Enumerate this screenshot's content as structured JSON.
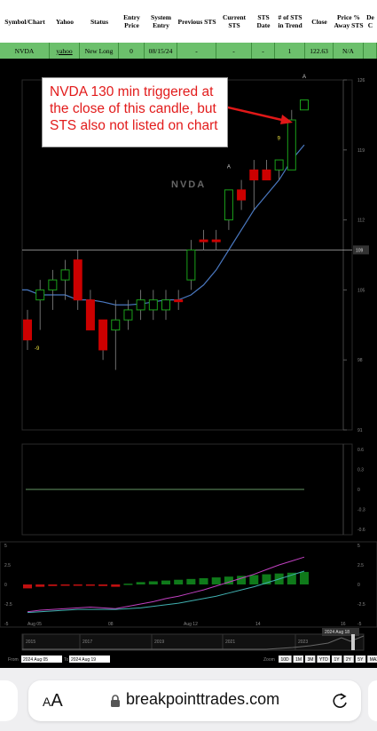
{
  "table": {
    "headers": [
      "Symbol/Chart",
      "Yahoo",
      "Status",
      "Entry Price",
      "System Entry",
      "Previous STS",
      "Current STS",
      "STS Date",
      "# of STS in Trend",
      "Close",
      "Price % Away STS",
      "De C"
    ],
    "row": [
      "NVDA",
      "yahoo",
      "New Long",
      "0",
      "08/15/24",
      "-",
      "-",
      "-",
      "1",
      "122.63",
      "N/A",
      ""
    ]
  },
  "annotation": "NVDA 130 min triggered at the close of this candle, but STS also not listed on chart",
  "chart": {
    "watermark": "NVDA",
    "price_level_label": "109",
    "price_axis": [
      "126",
      "119",
      "112",
      "105",
      "98",
      "91"
    ],
    "osc_axis": [
      "0.6",
      "0.3",
      "0",
      "-0.3",
      "-0.6"
    ],
    "macd_axis": [
      "5",
      "2.5",
      "0",
      "-2.5",
      "-5"
    ],
    "x_axis": [
      "Aug 05",
      "08",
      "Aug 12",
      "14",
      "16"
    ],
    "labels": {
      "A1": "A",
      "A2": "A",
      "nine1": "9",
      "nine2": "-9"
    },
    "navigator_years": [
      "2015",
      "2017",
      "2019",
      "2021",
      "2023"
    ],
    "navigator_badge": "2024 Aug 18",
    "from_label": "From",
    "from_value": "2024 Aug 05",
    "to_label": "To",
    "to_value": "2024 Aug 19",
    "zoom_label": "Zoom",
    "zoom_buttons": [
      "10D",
      "1M",
      "3M",
      "YTD",
      "1Y",
      "2Y",
      "5Y",
      "MAX"
    ]
  },
  "chart_data": {
    "type": "candlestick",
    "candles": [
      {
        "o": 102,
        "h": 103,
        "l": 99,
        "c": 100,
        "color": "red"
      },
      {
        "o": 104,
        "h": 106,
        "l": 101,
        "c": 105,
        "color": "green"
      },
      {
        "o": 105,
        "h": 107,
        "l": 103,
        "c": 106,
        "color": "green"
      },
      {
        "o": 107,
        "h": 108,
        "l": 104,
        "c": 106,
        "color": "green"
      },
      {
        "o": 108,
        "h": 109,
        "l": 103,
        "c": 104,
        "color": "red"
      },
      {
        "o": 104,
        "h": 105,
        "l": 101,
        "c": 101,
        "color": "red"
      },
      {
        "o": 102,
        "h": 102,
        "l": 98,
        "c": 99,
        "color": "red"
      },
      {
        "o": 101,
        "h": 104,
        "l": 97,
        "c": 102,
        "color": "green"
      },
      {
        "o": 102,
        "h": 104,
        "l": 101,
        "c": 103,
        "color": "green"
      },
      {
        "o": 103,
        "h": 105,
        "l": 102,
        "c": 104,
        "color": "green"
      },
      {
        "o": 104,
        "h": 105,
        "l": 102,
        "c": 103,
        "color": "green"
      },
      {
        "o": 103,
        "h": 105,
        "l": 102,
        "c": 104,
        "color": "green"
      },
      {
        "o": 104,
        "h": 105,
        "l": 103,
        "c": 104,
        "color": "red"
      },
      {
        "o": 106,
        "h": 110,
        "l": 105,
        "c": 109,
        "color": "green"
      },
      {
        "o": 110,
        "h": 111,
        "l": 109,
        "c": 110,
        "color": "red"
      },
      {
        "o": 110,
        "h": 111,
        "l": 109,
        "c": 110,
        "color": "red"
      },
      {
        "o": 112,
        "h": 115,
        "l": 111,
        "c": 115,
        "color": "green"
      },
      {
        "o": 115,
        "h": 116,
        "l": 113,
        "c": 114,
        "color": "red"
      },
      {
        "o": 117,
        "h": 118,
        "l": 113,
        "c": 116,
        "color": "red"
      },
      {
        "o": 117,
        "h": 118,
        "l": 116,
        "c": 116,
        "color": "red"
      },
      {
        "o": 117,
        "h": 118,
        "l": 116,
        "c": 118,
        "color": "green"
      },
      {
        "o": 117,
        "h": 123,
        "l": 117,
        "c": 122,
        "color": "green"
      },
      {
        "o": 123,
        "h": 124,
        "l": 123,
        "c": 124,
        "color": "green"
      }
    ],
    "moving_average": [
      105,
      104.5,
      104.5,
      104.5,
      104,
      104,
      103.8,
      103.5,
      103.5,
      103.6,
      103.8,
      104,
      104,
      104.5,
      105.5,
      107,
      109,
      111,
      113,
      114.5,
      116,
      118,
      119.5
    ],
    "horizontal_line": 109,
    "osc_line": 0,
    "macd_hist": [
      -0.5,
      -0.3,
      -0.2,
      -0.1,
      -0.1,
      -0.1,
      -0.2,
      -0.3,
      0.1,
      0.3,
      0.4,
      0.5,
      0.6,
      0.7,
      0.8,
      0.9,
      1.0,
      1.1,
      1.2,
      1.3,
      1.4,
      1.5,
      1.6
    ],
    "macd_line_pink": [
      -3.5,
      -3.3,
      -3.2,
      -3.1,
      -3.0,
      -2.9,
      -3.0,
      -3.1,
      -2.8,
      -2.5,
      -2.2,
      -1.8,
      -1.5,
      -1.1,
      -0.7,
      -0.2,
      0.3,
      0.8,
      1.3,
      1.9,
      2.5,
      3.0,
      3.5
    ],
    "macd_line_teal": [
      -3.6,
      -3.5,
      -3.4,
      -3.3,
      -3.2,
      -3.2,
      -3.2,
      -3.2,
      -3.1,
      -3.0,
      -2.8,
      -2.6,
      -2.4,
      -2.1,
      -1.8,
      -1.5,
      -1.1,
      -0.7,
      -0.3,
      0.2,
      0.7,
      1.2,
      1.7
    ]
  }
}
